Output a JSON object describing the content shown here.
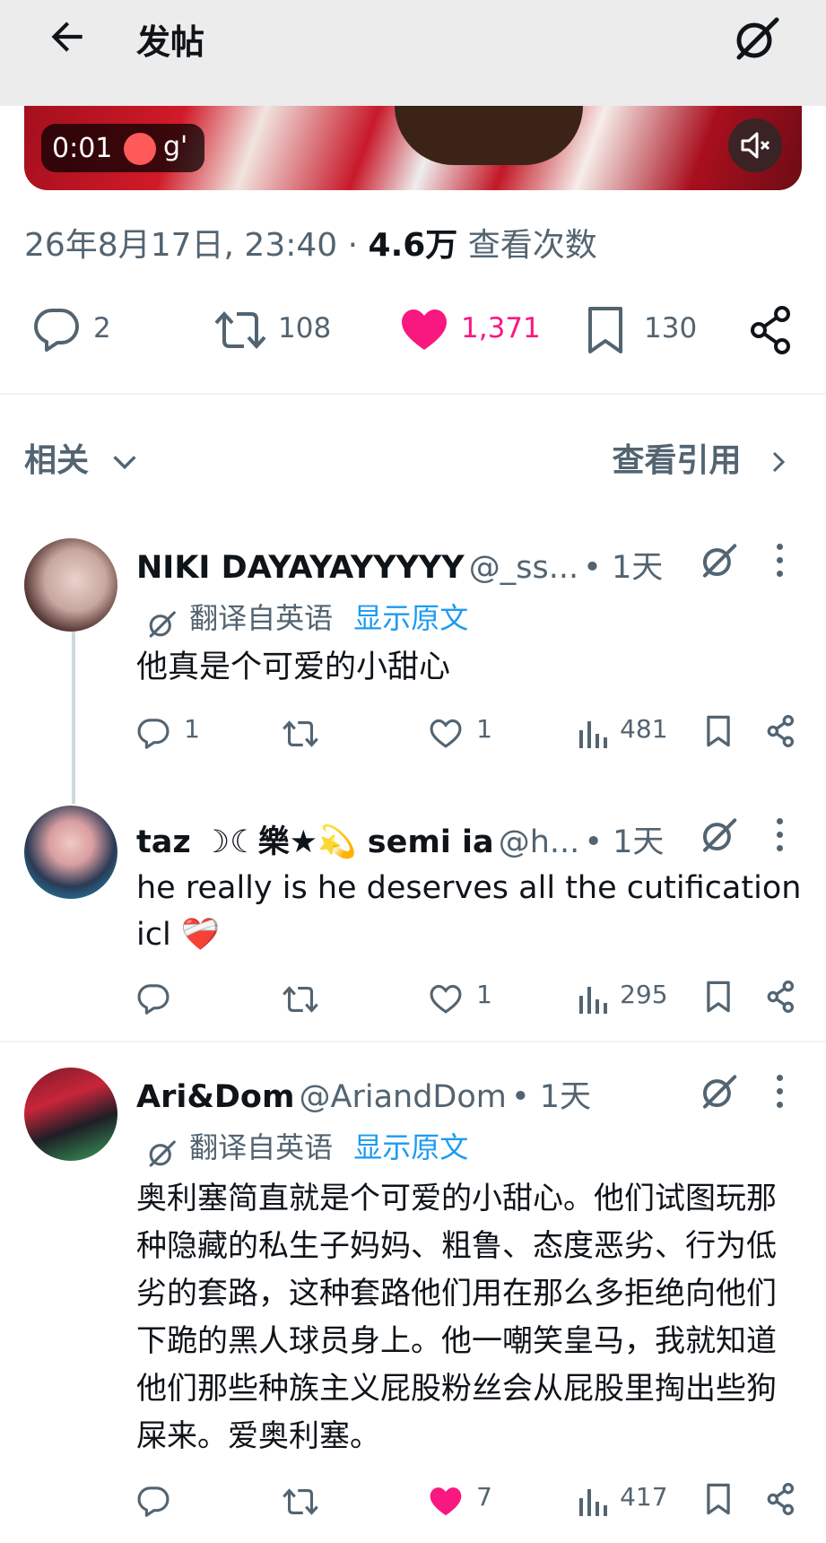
{
  "header": {
    "title": "发帖",
    "back_icon": "arrow-left-icon",
    "grok_icon": "grok-icon"
  },
  "video": {
    "time": "0:01",
    "overlay_text": "g'"
  },
  "post_meta": {
    "timestamp": "26年8月17日, 23:40",
    "separator": "·",
    "views_count": "4.6万",
    "views_label": "查看次数"
  },
  "actions": {
    "replies": "2",
    "reposts": "108",
    "likes": "1,371",
    "bookmarks": "130"
  },
  "colors": {
    "like_pink": "#f91880",
    "link_blue": "#1d9bf0",
    "secondary": "#536471"
  },
  "section": {
    "related": "相关",
    "view_quotes": "查看引用"
  },
  "replies": [
    {
      "name": "NIKI DAYAYAYYYYY",
      "handle": "@_ss...",
      "time": "• 1天",
      "translated_label": "翻译自英语",
      "show_original": "显示原文",
      "text": "他真是个可爱的小甜心",
      "stats": {
        "replies": "1",
        "reposts": "",
        "likes": "1",
        "views": "481"
      }
    },
    {
      "name": "taz ☽☾樂★💫 semi ia",
      "handle": "@h...",
      "time": "• 1天",
      "text": "he really is he deserves all the cutification icl ❤️‍🩹",
      "stats": {
        "replies": "",
        "reposts": "",
        "likes": "1",
        "views": "295"
      }
    },
    {
      "name": "Ari&Dom",
      "handle": "@AriandDom",
      "time": "• 1天",
      "translated_label": "翻译自英语",
      "show_original": "显示原文",
      "text": "奥利塞简直就是个可爱的小甜心。他们试图玩那种隐藏的私生子妈妈、粗鲁、态度恶劣、行为低劣的套路，这种套路他们用在那么多拒绝向他们下跪的黑人球员身上。他一嘲笑皇马，我就知道他们那些种族主义屁股粉丝会从屁股里掏出些狗屎来。爱奥利塞。",
      "stats": {
        "replies": "",
        "reposts": "",
        "likes": "7",
        "views": "417"
      }
    }
  ]
}
